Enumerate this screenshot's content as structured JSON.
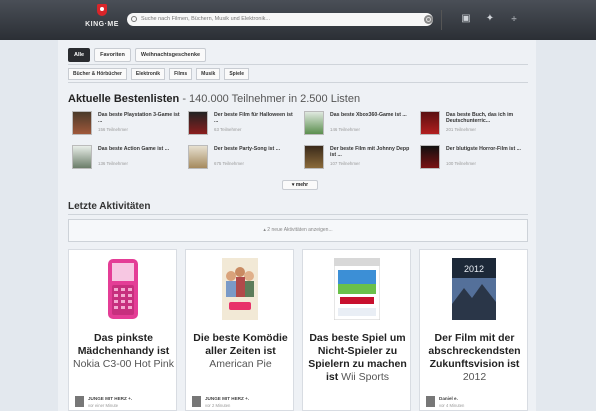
{
  "header": {
    "logo_text": "KING·ME",
    "search_placeholder": "Suche nach Filmen, Büchern, Musik und Elektronik..."
  },
  "tabs": [
    "Alle",
    "Favoriten",
    "Weihnachtsgeschenke"
  ],
  "categories": [
    "Bücher & Hörbücher",
    "Elektronik",
    "Films",
    "Musik",
    "Spiele"
  ],
  "bestlists": {
    "heading_strong": "Aktuelle Bestenlisten",
    "heading_light": " - 140.000 Teilnehmer in 2.500 Listen",
    "items": [
      {
        "title": "Das beste Playstation 3-Game ist ...",
        "meta": "156 Teilnehmer"
      },
      {
        "title": "Der beste Film für Halloween ist ...",
        "meta": "63 Teilnehmer"
      },
      {
        "title": "Das beste Xbox360-Game ist ...",
        "meta": "146 Teilnehmer"
      },
      {
        "title": "Das beste Buch, das ich im Deutschunterric...",
        "meta": "201 Teilnehmer"
      },
      {
        "title": "Das beste Action Game ist ...",
        "meta": "136 Teilnehmer"
      },
      {
        "title": "Der beste Party-Song ist ...",
        "meta": "675 Teilnehmer"
      },
      {
        "title": "Der beste Film mit Johnny Depp ist ...",
        "meta": "107 Teilnehmer"
      },
      {
        "title": "Der blutigste Horror-Film ist ...",
        "meta": "100 Teilnehmer"
      }
    ],
    "more_label": "mehr"
  },
  "activity": {
    "heading": "Letzte Aktivitäten",
    "notice": "2 neue Aktivitäten anzeigen...",
    "cards": [
      {
        "title": "Das pinkste Mädchenhandy ist ",
        "highlight": "Nokia C3-00 Hot Pink",
        "user": "JUNGE MIT HERZ +.",
        "time": "vor einer Minute"
      },
      {
        "title": "Die beste Komödie aller Zeiten ist ",
        "highlight": "American Pie",
        "user": "JUNGE MIT HERZ +.",
        "time": "vor 2 Minuten"
      },
      {
        "title": "Das beste Spiel um Nicht-Spieler zu Spielern zu machen ist ",
        "highlight": "Wii Sports",
        "user": "",
        "time": ""
      },
      {
        "title": "Der Film mit der abschreckendsten Zukunftsvision ist ",
        "highlight": "2012",
        "user": "Daniel e.",
        "time": "vor 4 Minuten"
      }
    ]
  },
  "colors": {
    "topbar": "#2b2f35",
    "logo": "#d9252a",
    "phone": "#e43d96"
  }
}
